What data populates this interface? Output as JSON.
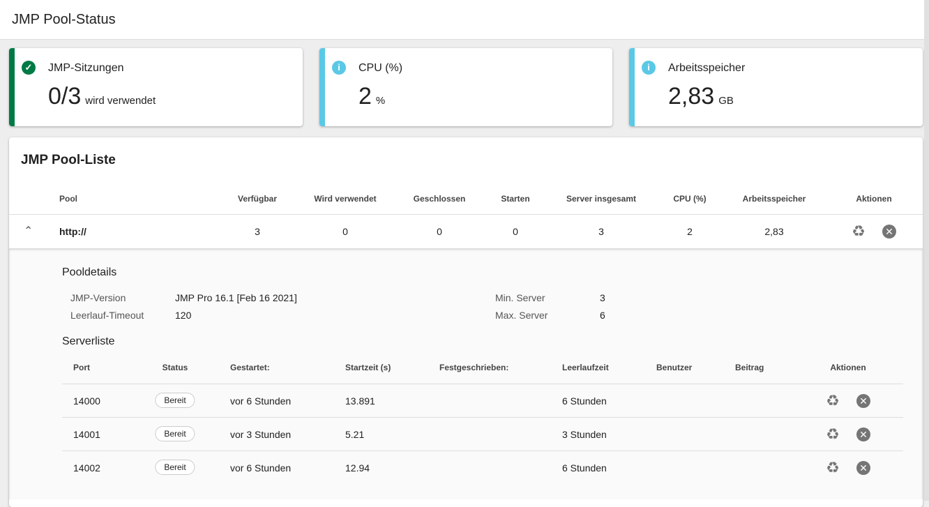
{
  "header": {
    "title": "JMP Pool-Status"
  },
  "cards": [
    {
      "title": "JMP-Sitzungen",
      "value": "0/3",
      "unit": "wird verwendet",
      "icon": "check-circle-icon",
      "color": "#007a45"
    },
    {
      "title": "CPU (%)",
      "value": "2",
      "unit": "%",
      "icon": "info-icon",
      "color": "#5bc8e6"
    },
    {
      "title": "Arbeitsspeicher",
      "value": "2,83",
      "unit": "GB",
      "icon": "info-icon",
      "color": "#5bc8e6"
    }
  ],
  "pool_list": {
    "title": "JMP Pool-Liste",
    "columns": [
      "Pool",
      "Verfügbar",
      "Wird verwendet",
      "Geschlossen",
      "Starten",
      "Server insgesamt",
      "CPU (%)",
      "Arbeitsspeicher",
      "Aktionen"
    ],
    "row": {
      "pool": "http://",
      "available": "3",
      "in_use": "0",
      "closed": "0",
      "starting": "0",
      "total": "3",
      "cpu": "2",
      "memory": "2,83"
    },
    "details": {
      "title": "Pooldetails",
      "jmp_version_label": "JMP-Version",
      "jmp_version": "JMP Pro 16.1 [Feb 16 2021]",
      "idle_timeout_label": "Leerlauf-Timeout",
      "idle_timeout": "120",
      "min_server_label": "Min. Server",
      "min_server": "3",
      "max_server_label": "Max. Server",
      "max_server": "6"
    },
    "server_list": {
      "title": "Serverliste",
      "columns": [
        "Port",
        "Status",
        "Gestartet:",
        "Startzeit (s)",
        "Festgeschrieben:",
        "Leerlaufzeit",
        "Benutzer",
        "Beitrag",
        "Aktionen"
      ],
      "rows": [
        {
          "port": "14000",
          "status": "Bereit",
          "started": "vor 6 Stunden",
          "startup": "13.891",
          "idle": "6 Stunden"
        },
        {
          "port": "14001",
          "status": "Bereit",
          "started": "vor 3 Stunden",
          "startup": "5.21",
          "idle": "3 Stunden"
        },
        {
          "port": "14002",
          "status": "Bereit",
          "started": "vor 6 Stunden",
          "startup": "12.94",
          "idle": "6 Stunden"
        }
      ]
    }
  }
}
